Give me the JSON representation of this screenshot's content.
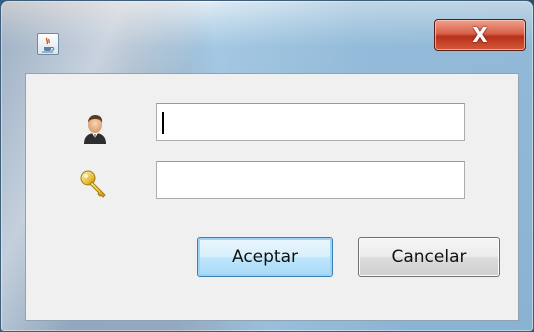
{
  "window": {
    "app_icon": "java-cup-icon",
    "close_label": "X",
    "close_icon": "close-icon"
  },
  "form": {
    "username_icon": "user-icon",
    "username_value": "",
    "password_icon": "key-icon",
    "password_value": ""
  },
  "buttons": {
    "accept_label": "Aceptar",
    "cancel_label": "Cancelar"
  },
  "colors": {
    "close_button": "#c94a32",
    "default_button_border": "#3c7fb1",
    "client_background": "#f0f0f0"
  }
}
